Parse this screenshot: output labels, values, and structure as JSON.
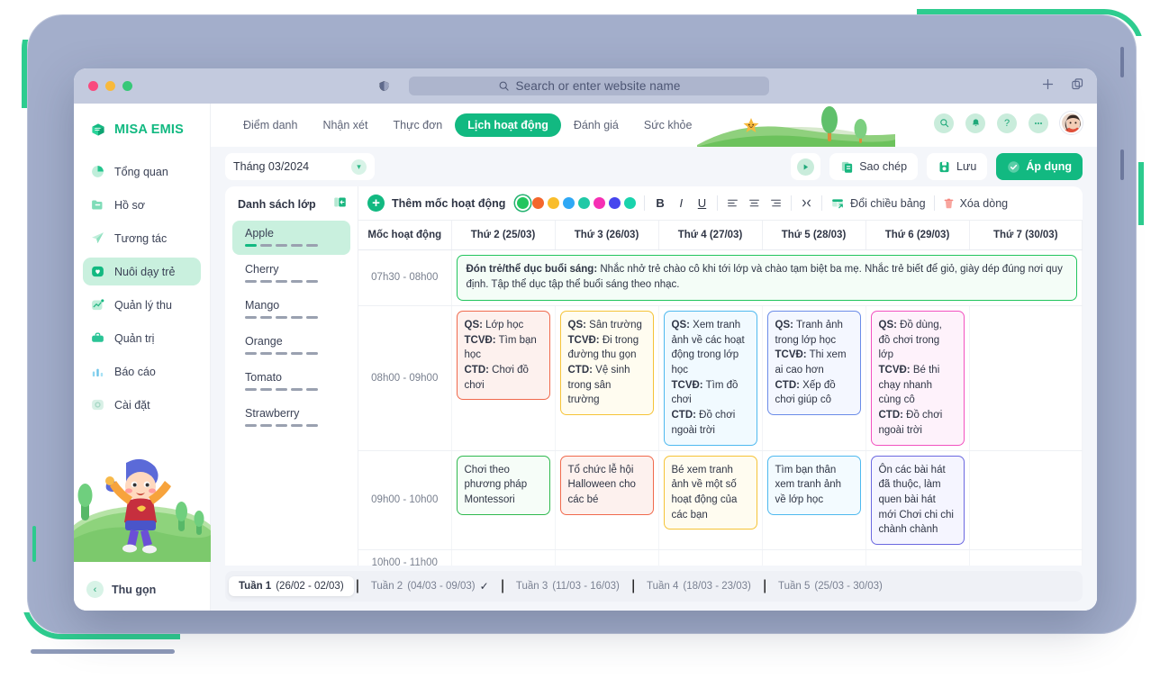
{
  "browser": {
    "shield_icon": "shield-icon",
    "url_placeholder": "Search or enter website name",
    "search_icon": "search-icon",
    "new_tab_icon": "plus-icon",
    "tabs_icon": "copy-tabs-icon"
  },
  "sidebar": {
    "brand": "MISA EMIS",
    "items": [
      {
        "label": "Tổng quan",
        "icon": "pie-chart-icon",
        "active": false
      },
      {
        "label": "Hồ sơ",
        "icon": "folder-icon",
        "active": false
      },
      {
        "label": "Tương tác",
        "icon": "paper-plane-icon",
        "active": false
      },
      {
        "label": "Nuôi dạy trẻ",
        "icon": "heart-home-icon",
        "active": true
      },
      {
        "label": "Quản lý thu",
        "icon": "trend-chart-icon",
        "active": false
      },
      {
        "label": "Quản trị",
        "icon": "briefcase-icon",
        "active": false
      },
      {
        "label": "Báo cáo",
        "icon": "bar-chart-icon",
        "active": false
      },
      {
        "label": "Cài đặt",
        "icon": "gear-icon",
        "active": false
      }
    ],
    "collapse_label": "Thu gọn",
    "collapse_icon": "chevron-left-icon"
  },
  "topnav": {
    "tabs": [
      {
        "label": "Điểm danh",
        "active": false
      },
      {
        "label": "Nhận xét",
        "active": false
      },
      {
        "label": "Thực đơn",
        "active": false
      },
      {
        "label": "Lịch hoạt động",
        "active": true
      },
      {
        "label": "Đánh giá",
        "active": false
      },
      {
        "label": "Sức khỏe",
        "active": false
      }
    ],
    "icons": [
      {
        "name": "search-icon",
        "glyph": "🔍"
      },
      {
        "name": "bell-icon",
        "glyph": "🔔"
      },
      {
        "name": "help-icon",
        "glyph": "?"
      },
      {
        "name": "more-icon",
        "glyph": "•••"
      }
    ],
    "avatar": "user-avatar"
  },
  "filterbar": {
    "month_value": "Tháng 03/2024",
    "month_chevron": "chevron-down-icon",
    "play_button": "play-icon",
    "copy_label": "Sao chép",
    "copy_icon": "copy-icon",
    "save_label": "Lưu",
    "save_icon": "save-icon",
    "apply_label": "Áp dụng",
    "apply_icon": "check-circle-icon"
  },
  "classpanel": {
    "title": "Danh sách lớp",
    "collapse_icon": "panel-collapse-icon",
    "classes": [
      {
        "name": "Apple",
        "active": true
      },
      {
        "name": "Cherry",
        "active": false
      },
      {
        "name": "Mango",
        "active": false
      },
      {
        "name": "Orange",
        "active": false
      },
      {
        "name": "Tomato",
        "active": false
      },
      {
        "name": "Strawberry",
        "active": false
      }
    ]
  },
  "toolbar": {
    "add_label": "Thêm mốc hoạt động",
    "add_icon": "plus-circle-icon",
    "colors": [
      "#22c55e",
      "#f4662c",
      "#f9bd2b",
      "#2fa8f5",
      "#20c9a6",
      "#f62fb4",
      "#4646ee",
      "#19d3ac"
    ],
    "selected_color_index": 0,
    "bold_label": "B",
    "italic_label": "I",
    "underline_label": "U",
    "align_left_icon": "align-left-icon",
    "align_center_icon": "align-center-icon",
    "align_right_icon": "align-right-icon",
    "merge_icon": "merge-cells-icon",
    "transpose_label": "Đổi chiều bảng",
    "transpose_icon": "transpose-table-icon",
    "delete_row_label": "Xóa dòng",
    "delete_row_icon": "trash-icon"
  },
  "table": {
    "headers": [
      "Mốc hoạt động",
      "Thứ 2 (25/03)",
      "Thứ 3 (26/03)",
      "Thứ 4 (27/03)",
      "Thứ 5 (28/03)",
      "Thứ 6 (29/03)",
      "Thứ 7 (30/03)"
    ],
    "rows": [
      {
        "time": "07h30 - 08h00",
        "banner": {
          "title": "Đón trẻ/thể dục buổi sáng:",
          "text": " Nhắc nhở trẻ chào cô khi tới lớp và chào tạm biệt ba mẹ. Nhắc trẻ biết để giỏ, giày dép đúng nơi quy định. Tập thể dục tập thể buổi sáng theo nhạc.",
          "border": "#22c55e",
          "bg": "#f4fdf7"
        }
      },
      {
        "time": "08h00 - 09h00",
        "cells": [
          {
            "border": "#f06a4d",
            "bg": "#fdf1ee",
            "lines": [
              {
                "k": "QS:",
                "v": " Lớp học"
              },
              {
                "k": "TCVĐ:",
                "v": " Tìm bạn học"
              },
              {
                "k": "CTD:",
                "v": " Chơi đồ chơi"
              }
            ]
          },
          {
            "border": "#f5c337",
            "bg": "#fffcf0",
            "lines": [
              {
                "k": "QS:",
                "v": " Sân trường"
              },
              {
                "k": "TCVĐ:",
                "v": " Đi trong đường thu gọn"
              },
              {
                "k": "CTD:",
                "v": " Vệ sinh trong sân trường"
              }
            ]
          },
          {
            "border": "#4fb9ef",
            "bg": "#f1faff",
            "lines": [
              {
                "k": "QS:",
                "v": " Xem tranh ảnh về các hoạt động trong lớp học"
              },
              {
                "k": "TCVĐ:",
                "v": " Tìm đồ chơi"
              },
              {
                "k": "CTD:",
                "v": " Đồ chơi ngoài trời"
              }
            ]
          },
          {
            "border": "#6b8ce8",
            "bg": "#f4f7ff",
            "lines": [
              {
                "k": "QS:",
                "v": " Tranh ảnh trong lớp học"
              },
              {
                "k": "TCVĐ:",
                "v": " Thi xem ai cao hơn"
              },
              {
                "k": "CTD:",
                "v": " Xếp đồ chơi giúp cô"
              }
            ]
          },
          {
            "border": "#f252c0",
            "bg": "#fef2fb",
            "lines": [
              {
                "k": "QS:",
                "v": " Đồ dùng, đồ chơi trong lớp"
              },
              {
                "k": "TCVĐ:",
                "v": " Bé thi chạy nhanh cùng cô"
              },
              {
                "k": "CTD:",
                "v": " Đồ chơi ngoài trời"
              }
            ]
          },
          null
        ]
      },
      {
        "time": "09h00 - 10h00",
        "cells": [
          {
            "border": "#2fb94f",
            "bg": "#f6fdf8",
            "text": "Chơi theo phương pháp Montessori"
          },
          {
            "border": "#f06a4d",
            "bg": "#fdf1ee",
            "text": "Tổ chức lễ hội Halloween cho các bé"
          },
          {
            "border": "#f5c337",
            "bg": "#fffcf0",
            "text": "Bé xem tranh ảnh về một số hoạt động của các bạn"
          },
          {
            "border": "#4fb9ef",
            "bg": "#f3fbff",
            "text": "Tìm bạn thân xem tranh ảnh về lớp học"
          },
          {
            "border": "#6b68e0",
            "bg": "#f5f5ff",
            "text": "Ôn các bài hát đã thuộc, làm quen bài hát mới Chơi chi chi chành chành"
          },
          null
        ]
      },
      {
        "time": "10h00 - 11h00",
        "cells": [
          null,
          null,
          null,
          null,
          null,
          null
        ]
      }
    ]
  },
  "weekbar": {
    "weeks": [
      {
        "num": "Tuần 1",
        "range": "(26/02 - 02/03)",
        "active": true,
        "check": false
      },
      {
        "num": "Tuần 2",
        "range": "(04/03 - 09/03)",
        "active": false,
        "check": true
      },
      {
        "num": "Tuần 3",
        "range": "(11/03 - 16/03)",
        "active": false,
        "check": false
      },
      {
        "num": "Tuần 4",
        "range": "(18/03 - 23/03)",
        "active": false,
        "check": false
      },
      {
        "num": "Tuần 5",
        "range": "(25/03 - 30/03)",
        "active": false,
        "check": false
      }
    ]
  },
  "colors": {
    "brand_green": "#12b981",
    "frame_blue": "#a3aecb",
    "accent_teal": "#2ecc8f"
  }
}
